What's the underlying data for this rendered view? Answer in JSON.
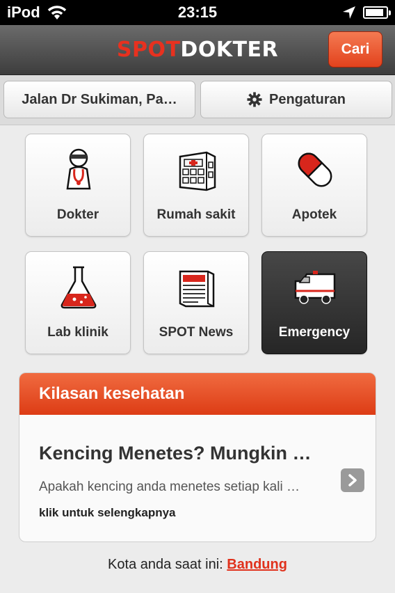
{
  "status_bar": {
    "carrier": "iPod",
    "time": "23:15",
    "icons": [
      "wifi-icon",
      "location-arrow-icon",
      "battery-icon"
    ],
    "battery_level": 0.9
  },
  "header": {
    "logo_part1": "SPOT",
    "logo_part2": "DOKTER",
    "search_button": "Cari"
  },
  "toolbar": {
    "location": "Jalan Dr Sukiman, Pa…",
    "settings": "Pengaturan",
    "settings_icon": "gear-icon"
  },
  "menu": [
    {
      "label": "Dokter",
      "icon": "doctor-icon"
    },
    {
      "label": "Rumah sakit",
      "icon": "hospital-icon"
    },
    {
      "label": "Apotek",
      "icon": "pill-icon"
    },
    {
      "label": "Lab klinik",
      "icon": "flask-icon"
    },
    {
      "label": "SPOT News",
      "icon": "newspaper-icon"
    },
    {
      "label": "Emergency",
      "icon": "ambulance-icon"
    }
  ],
  "news": {
    "header": "Kilasan kesehatan",
    "title": "Kencing Menetes? Mungkin …",
    "snippet": "Apakah kencing anda menetes setiap kali …",
    "more": "klik untuk selengkapnya"
  },
  "footer": {
    "label": "Kota anda saat ini:",
    "city": "Bandung"
  },
  "colors": {
    "accent": "#e2421d",
    "logo_red": "#e8311f"
  }
}
